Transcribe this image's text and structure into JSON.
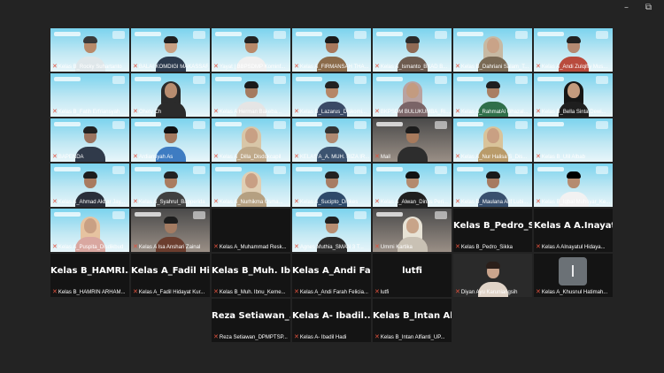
{
  "window_controls": {
    "minimize": "–",
    "maximize": "⧉"
  },
  "participants": [
    {
      "label": "Kelas B_Rocky Suhartanto",
      "type": "video",
      "person": {
        "skin": "#b88a6a",
        "hair": "#3a3a3a",
        "hijab": null,
        "shirt": "#dfe7ea"
      }
    },
    {
      "label": "BALAI KOMDIGI MAKASSAR",
      "type": "video",
      "person": {
        "skin": "#c8a083",
        "hair": "#1f1f1f",
        "hijab": null,
        "shirt": "#2c3a4d"
      }
    },
    {
      "label": "Yayat | BBPSDMP Kominf...",
      "type": "video",
      "person": {
        "skin": "#b8896a",
        "hair": "#222",
        "hijab": null,
        "shirt": "#f0f0f0"
      }
    },
    {
      "label": "Kelas A_FIRMANSAH THA...",
      "type": "video",
      "person": {
        "skin": "#a8785c",
        "hair": "#1a1a1a",
        "hijab": null,
        "shirt": "#8b6b4a"
      }
    },
    {
      "label": "Kelas A_Ismanto_BKAD B...",
      "type": "video",
      "person": {
        "skin": "#8f6a55",
        "hair": "#2a2a2a",
        "hijab": null,
        "shirt": "#6d5b4f"
      }
    },
    {
      "label": "Kelas B_Dahriani Salam_T...",
      "type": "video",
      "person": {
        "skin": "#c9a388",
        "hair": null,
        "hijab": "#c7b9a3",
        "shirt": "#7a6a55"
      }
    },
    {
      "label": "Kelas A_Andi Zulqifly Mus...",
      "type": "video",
      "person": {
        "skin": "#b58a72",
        "hair": "#222",
        "hijab": null,
        "shirt": "#b94b3d"
      }
    },
    {
      "label": "Kelas B_Fatih Erfriansyah",
      "type": "video",
      "person": null
    },
    {
      "label": "Ohety Ch",
      "type": "video",
      "person": {
        "skin": "#b88d70",
        "hair": null,
        "hijab": "#2b2b2b",
        "shirt": "#2b2b2b"
      }
    },
    {
      "label": "Kelas A Herman Bakeba...",
      "type": "video",
      "person": {
        "skin": "#a47a60",
        "hair": "#1a1a1a",
        "hijab": null,
        "shirt": "#e5e5e5"
      }
    },
    {
      "label": "Kelas B_Lazarus_Diskomi...",
      "type": "video",
      "person": {
        "skin": "#b58667",
        "hair": "#222",
        "hijab": null,
        "shirt": "#3a4a66"
      }
    },
    {
      "label": "BKPSDM BULUKUMBA_Ri...",
      "type": "video",
      "person": {
        "skin": "#c39b80",
        "hair": null,
        "hijab": "#b9a2a0",
        "shirt": "#7a6467"
      }
    },
    {
      "label": "Kelas A_RahmatAl Ghazal...",
      "type": "video",
      "person": {
        "skin": "#a97f63",
        "hair": "#1f1f1f",
        "hijab": null,
        "shirt": "#2f6f4a"
      }
    },
    {
      "label": "Kelas B_Bella Sinta Dewi...",
      "type": "video",
      "person": {
        "skin": "#c49b7e",
        "hair": null,
        "hijab": "#161616",
        "shirt": "#1e1e1e"
      }
    },
    {
      "label": "BAPENDA",
      "type": "video",
      "person": {
        "skin": "#9b7460",
        "hair": "#222",
        "hijab": null,
        "shirt": "#303a4a"
      }
    },
    {
      "label": "Ardiansyah As",
      "type": "video",
      "person": {
        "skin": "#a47a60",
        "hair": "#111",
        "hijab": null,
        "shirt": "#3e7cc2"
      }
    },
    {
      "label": "Kelas A_Dilla_Disdukcapil",
      "type": "video",
      "person": {
        "skin": "#c8a084",
        "hair": null,
        "hijab": "#d8c6a8",
        "shirt": "#bfa98a"
      }
    },
    {
      "label": "KELAS A_A. MUH. RIZA IR...",
      "type": "video",
      "person": {
        "skin": "#b08a72",
        "hair": "#333",
        "hijab": null,
        "shirt": "#3c5370"
      }
    },
    {
      "label": "Mail",
      "type": "dark",
      "person": {
        "skin": "#a77a5c",
        "hair": "#1c1c1c",
        "hijab": null,
        "shirt": "#2d2d2d"
      }
    },
    {
      "label": "Kelas A_Nur Halisa S_Dis...",
      "type": "video",
      "person": {
        "skin": "#c9a083",
        "hair": null,
        "hijab": "#d9c39a",
        "shirt": "#b99b6a"
      }
    },
    {
      "label": "Kelas B_Ulil Albab",
      "type": "video",
      "person": null
    },
    {
      "label": "Kelas A_Ahmad Akbar Jay...",
      "type": "video",
      "person": {
        "skin": "#a87b60",
        "hair": "#1d1d1d",
        "hijab": null,
        "shirt": "#2a2f3a"
      }
    },
    {
      "label": "Kelas A_Syahrul_Bapperida",
      "type": "video",
      "person": {
        "skin": "#a97c60",
        "hair": "#222",
        "hijab": null,
        "shirt": "#404040"
      }
    },
    {
      "label": "Kelas A_Nurhikma Usma...",
      "type": "video",
      "person": {
        "skin": "#c89f84",
        "hair": null,
        "hijab": "#e0cfb4",
        "shirt": "#b5a081"
      }
    },
    {
      "label": "Kelas A_Sucipto_Dinkes",
      "type": "video",
      "person": {
        "skin": "#a77d64",
        "hair": "#222",
        "hijab": null,
        "shirt": "#2e4a6a"
      }
    },
    {
      "label": "Kelas A_Alwan_Dinas Peri...",
      "type": "video",
      "person": {
        "skin": "#b38a6e",
        "hair": "#111",
        "hijab": null,
        "shirt": "#1f1f1f"
      }
    },
    {
      "label": "Kelas B_Maulana Arif Lubi...",
      "type": "video",
      "person": {
        "skin": "#a67b61",
        "hair": "#1a1a1a",
        "hijab": null,
        "shirt": "#39506e"
      }
    },
    {
      "label": "Kelas B_Iqbal Muhsyar_Ke...",
      "type": "video",
      "person": {
        "skin": "#b58b70",
        "hair": "#000",
        "hijab": null,
        "shirt": "#f2f2f2"
      }
    },
    {
      "label": "Kelas A_Puspita_Disdikbud",
      "type": "video",
      "person": {
        "skin": "#c9a084",
        "hair": null,
        "hijab": "#e6c3a0",
        "shirt": "#d9a7a0"
      }
    },
    {
      "label": "Kelas A Isa Anshari Zainal",
      "type": "dark",
      "person": {
        "skin": "#a37b62",
        "hair": "#1d1d1d",
        "hijab": null,
        "shirt": "#6b3d2e"
      }
    },
    {
      "label": "Kelas A_Muhammad Resk...",
      "type": "blank",
      "big": ""
    },
    {
      "label": "Agnes Muthia_SMAN 3 T...",
      "type": "video",
      "person": {
        "skin": "#b88e72",
        "hair": "#202020",
        "hijab": null,
        "shirt": "#2a2a2a"
      }
    },
    {
      "label": "Ummi Kartika",
      "type": "dark",
      "person": {
        "skin": "#c8a489",
        "hair": null,
        "hijab": "#e8e3d6",
        "shirt": "#c9c1b4"
      }
    },
    {
      "label": "Kelas B_Pedro_Sikka",
      "type": "blank",
      "big": "Kelas B_Pedro_S..."
    },
    {
      "label": "Kelas A AInayatul Hidaya...",
      "type": "blank",
      "big": "Kelas A A.Inayat..."
    },
    {
      "label": "Kelas B_HAMRIN ARHAM...",
      "type": "blank",
      "big": "Kelas B_HAMRI..."
    },
    {
      "label": "Kelas A_Fadil Hidayat Kur...",
      "type": "blank",
      "big": "Kelas A_Fadil Hi..."
    },
    {
      "label": "Kelas B_Muh. Ibnu_Keme...",
      "type": "blank",
      "big": "Kelas B_Muh. Ib..."
    },
    {
      "label": "Kelas A_Andi Farah Felicia...",
      "type": "blank",
      "big": "Kelas A_Andi Fa..."
    },
    {
      "label": "lutfi",
      "type": "blank",
      "big": "lutfi"
    },
    {
      "label": "Diyan Ayu Karuniangsih",
      "type": "plain",
      "person": {
        "skin": "#c9a48c",
        "hair": "#2b1f1a",
        "hijab": null,
        "shirt": "#e1d4c8"
      }
    },
    {
      "label": "Kelas A_Khusnul Hatimah...",
      "type": "avatar",
      "avatar_letter": "I"
    },
    {
      "label": "Reza Setiawan_DPMPTSP...",
      "type": "blank",
      "big": "Reza Setiawan_..."
    },
    {
      "label": "Kelas A- Ibadil Hadi",
      "type": "blank",
      "big": "Kelas A- Ibadil..."
    },
    {
      "label": "Kelas B_Intan Alfianti_UP...",
      "type": "blank",
      "big": "Kelas B_Intan Al..."
    }
  ]
}
